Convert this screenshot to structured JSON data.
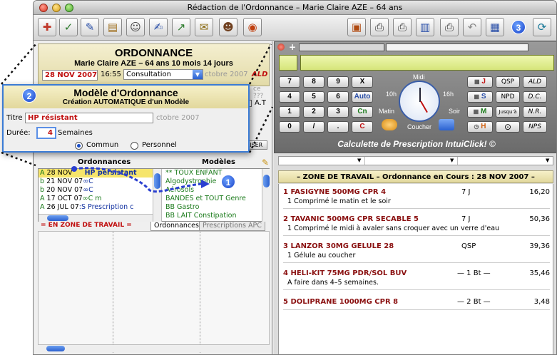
{
  "window": {
    "title": "Rédaction de l'Ordonnance – Marie Claire AZE – 64 ans"
  },
  "toolbar": {
    "left_icons": [
      "stethoscope-icon",
      "checklist-icon",
      "notepad-icon",
      "folder-icon",
      "person-icon",
      "pen-icon",
      "chart-icon",
      "document-icon",
      "portrait-icon",
      "owl-icon"
    ],
    "right_icons": [
      "book-icon",
      "printer-icon",
      "printer-alt-icon",
      "trash-icon",
      "print-icon",
      "undo-icon",
      "calendar-icon",
      "refresh-icon"
    ],
    "badge_3": "3"
  },
  "ordonnance": {
    "title": "ORDONNANCE",
    "patient": "Marie Claire AZE – 64 ans 10 mois 14 jours",
    "date": "28 NOV 2007",
    "time": "16:55",
    "type": "Consultation",
    "ghost_date": "ctobre 2007",
    "ald": "ALD",
    "ghost_ce": "ce ???",
    "at": "A.T",
    "liser": "LISER"
  },
  "modal": {
    "badge": "2",
    "title": "Modèle d'Ordonnance",
    "subtitle": "Création AUTOMATIQUE d'un Modèle",
    "titre_label": "Titre",
    "titre_value": "HP résistant",
    "ghost_date": "ctobre 2007",
    "duree_label": "Durée:",
    "duree_value": "4",
    "duree_unit": "Semaines",
    "radio_commun": "Commun",
    "radio_personnel": "Personnel"
  },
  "lists": {
    "col_left": "Ordonnances",
    "col_right": "Modèles",
    "ordonnances": [
      {
        "prefix": "A",
        "date": "28 NOV",
        "rest": "HP persistant"
      },
      {
        "prefix": "b",
        "date": "21 NOV 07",
        "rest": "∞C"
      },
      {
        "prefix": "b",
        "date": "20 NOV 07",
        "rest": "∞C"
      },
      {
        "prefix": "A",
        "date": "17 OCT 07",
        "rest": "∞C m"
      },
      {
        "prefix": "A",
        "date": "26 JUL 07",
        "rest": ":S    Prescription c"
      }
    ],
    "modeles": [
      "** TOUX ENFANT",
      "Algodystrophie",
      "Aérosols",
      "BANDES et TOUT Genre",
      "BB Gastro",
      "BB LAIT Constipation"
    ],
    "badge_1": "1",
    "tab_zone": "=   EN  ZONE DE TRAVAIL   =",
    "tab_ordonnances": "Ordonnances",
    "tab_prescriptions": "Prescriptions APC"
  },
  "calculette": {
    "keys": [
      "7",
      "8",
      "9",
      "X",
      "4",
      "5",
      "6",
      "Auto",
      "1",
      "2",
      "3",
      "Cn",
      "0",
      "/",
      ".",
      "C"
    ],
    "labels": {
      "midi": "Midi",
      "h10": "10h",
      "h16": "16h",
      "matin": "Matin",
      "soir": "Soir",
      "coucher": "Coucher"
    },
    "right_keys": [
      "J",
      "S",
      "M",
      "H"
    ],
    "side_keys": [
      "QSP",
      "ALD",
      "NPD",
      "D.C.",
      "Jusqu'à",
      "N.R.",
      "NPS"
    ],
    "caption": "Calculette de Prescription IntuiClick! ©"
  },
  "zone": {
    "header": "– ZONE DE TRAVAIL – Ordonnance en Cours : 28 NOV 2007 –",
    "meds": [
      {
        "num": "1",
        "name": "FASIGYNE 500MG CPR 4",
        "duration": "7 J",
        "price": "16,20",
        "note": "1 Comprimé le matin et le soir"
      },
      {
        "num": "2",
        "name": "TAVANIC 500MG CPR SECABLE 5",
        "duration": "7 J",
        "price": "50,36",
        "note": "1 Comprimé le midi  à avaler sans croquer avec un verre d'eau"
      },
      {
        "num": "3",
        "name": "LANZOR 30MG GELULE 28",
        "duration": "QSP",
        "price": "39,36",
        "note": "1 Gélule au coucher"
      },
      {
        "num": "4",
        "name": "HELI-KIT 75MG PDR/SOL BUV",
        "duration": "— 1 Bt —",
        "price": "35,46",
        "note": "A faire dans 4–5 semaines."
      },
      {
        "num": "5",
        "name": "DOLIPRANE 1000MG CPR 8",
        "duration": "— 2 Bt —",
        "price": "3,48",
        "note": ""
      }
    ]
  },
  "colors": {
    "accent": "#2b61d0",
    "med_red": "#8a1010",
    "header_bg": "#e2d89c"
  }
}
